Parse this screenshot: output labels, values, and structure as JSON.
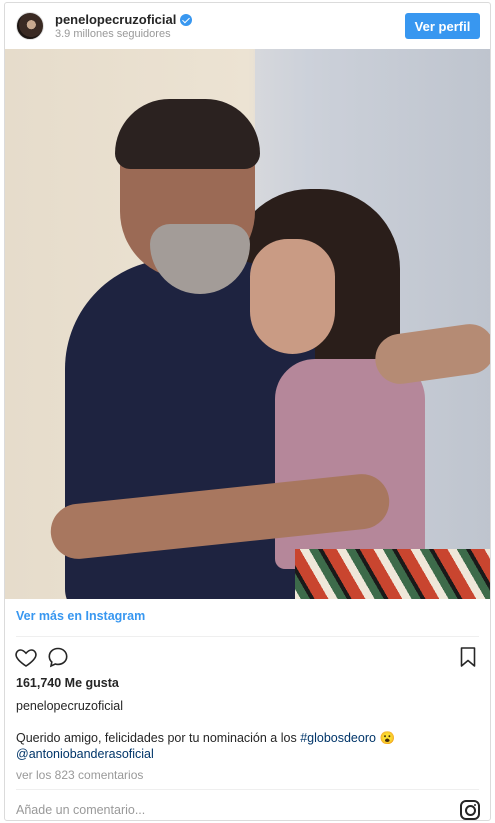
{
  "header": {
    "username": "penelopecruzoficial",
    "followers": "3.9 millones seguidores",
    "profile_button": "Ver perfil"
  },
  "post": {
    "more_link": "Ver más en Instagram",
    "likes": "161,740 Me gusta",
    "owner": "penelopecruzoficial",
    "caption_text": "Querido amigo, felicidades por tu nominación a los ",
    "caption_hashtag": "#globosdeoro",
    "caption_emoji": "😮",
    "caption_mention": "@antoniobanderasoficial",
    "comments_link": "ver los 823 comentarios"
  },
  "comment_box": {
    "placeholder": "Añade un comentario..."
  },
  "icons": {
    "like": "heart-icon",
    "comment": "comment-icon",
    "save": "bookmark-icon",
    "brand": "instagram-icon",
    "verified": "verified-badge-icon"
  },
  "colors": {
    "accent": "#3897f0",
    "text": "#262626",
    "muted": "#999999",
    "link_dark": "#003569"
  }
}
